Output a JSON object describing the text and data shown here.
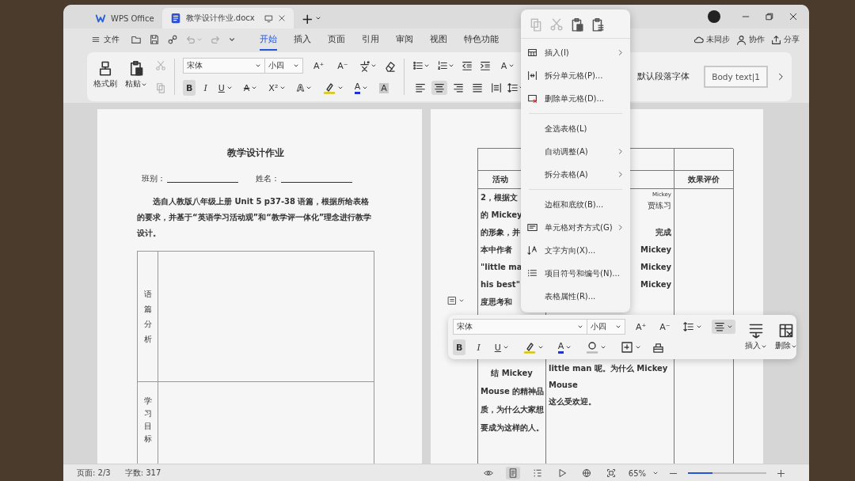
{
  "window": {
    "tabs": [
      {
        "label": "WPS Office",
        "selected": false
      },
      {
        "label": "教学设计作业.docx",
        "selected": true
      }
    ],
    "new_tab": "+"
  },
  "menubar": {
    "file": "文件",
    "tabs": [
      {
        "label": "开始",
        "selected": true
      },
      {
        "label": "插入",
        "selected": false
      },
      {
        "label": "页面",
        "selected": false
      },
      {
        "label": "引用",
        "selected": false
      },
      {
        "label": "审阅",
        "selected": false
      },
      {
        "label": "视图",
        "selected": false
      },
      {
        "label": "特色功能",
        "selected": false
      }
    ],
    "actions": [
      "未同步",
      "协作",
      "分享"
    ]
  },
  "ribbon": {
    "clipboard": [
      "格式刷",
      "粘贴"
    ],
    "clipboard_tools": [
      {
        "disabled": true
      },
      {
        "disabled": true
      }
    ],
    "font": "宋体",
    "size": "小四",
    "size_buttons": [
      "A⁺",
      "A⁻"
    ],
    "format_buttons": [
      {
        "label": "B",
        "kind": "bold",
        "selected": true
      },
      {
        "label": "I",
        "kind": "italic",
        "selected": false
      },
      {
        "label": "U",
        "kind": "underline",
        "selected": false
      },
      {
        "label": "A",
        "kind": "strike",
        "selected": false
      },
      {
        "label": "X²",
        "kind": "superscript",
        "selected": false
      },
      {
        "label": "A",
        "kind": "outline",
        "selected": false
      },
      {
        "kind": "highlight",
        "selected": false
      },
      {
        "label": "A",
        "kind": "font-color",
        "selected": false
      },
      {
        "label": "A",
        "kind": "shading",
        "selected": false
      }
    ],
    "text_effect_button": "A",
    "align": [
      {
        "selected": false
      },
      {
        "selected": true
      },
      {
        "selected": false
      },
      {
        "selected": false
      },
      {
        "selected": false
      }
    ],
    "styles": [
      {
        "label": "默认段落字体",
        "selected": false
      },
      {
        "label": "Body text|1",
        "selected": true
      }
    ]
  },
  "document": {
    "left_page": {
      "title": "教学设计作业",
      "fields": [
        "班别：",
        "姓名："
      ],
      "paragraph": "选自人教版八年级上册 Unit 5 p37-38 语篇，根据所给表格的要求，并基于“英语学习活动观”和“教学评一体化”理念进行教学设计。",
      "table_rows": [
        "语篇分析",
        "学习目标"
      ]
    },
    "right_page": {
      "headers": [
        "活动",
        "效果评价"
      ],
      "column_1_top": [
        "2，根据文",
        "的 Mickey",
        "的形象，并",
        "本中作者",
        "\"little ma",
        "his best\"",
        "度思考和"
      ],
      "column_1_bottom": [
        "结 Mickey",
        "Mouse 的精神品",
        "质，为什么大家想",
        "要成为这样的人。"
      ],
      "column_2_top": [
        {
          "text": "Mickey",
          "kind": "note"
        },
        {
          "text": "贾练习",
          "kind": "note"
        },
        {
          "text": "完成",
          "kind": "line"
        },
        {
          "text": "Mickey",
          "kind": "line"
        },
        {
          "text": "Mickey",
          "kind": "line"
        },
        {
          "text": "Mickey",
          "kind": "line"
        }
      ],
      "column_2_bottom": [
        "little man 呢。为什么 Mickey Mouse",
        "这么受欢迎。"
      ]
    }
  },
  "context_menu": {
    "tools": [
      {
        "disabled": true
      },
      {
        "disabled": true
      },
      {
        "disabled": false
      },
      {
        "disabled": false
      }
    ],
    "items": [
      {
        "kind": "item",
        "label": "插入(I)",
        "submenu": true
      },
      {
        "kind": "item",
        "label": "拆分单元格(P)...",
        "submenu": false
      },
      {
        "kind": "item",
        "label": "删除单元格(D)...",
        "submenu": false
      },
      {
        "kind": "separator"
      },
      {
        "kind": "item",
        "label": "全选表格(L)",
        "submenu": false
      },
      {
        "kind": "item",
        "label": "自动调整(A)",
        "submenu": true
      },
      {
        "kind": "item",
        "label": "拆分表格(A)",
        "submenu": true
      },
      {
        "kind": "separator"
      },
      {
        "kind": "item",
        "label": "边框和底纹(B)...",
        "submenu": false
      },
      {
        "kind": "item",
        "label": "单元格对齐方式(G)",
        "submenu": true
      },
      {
        "kind": "item",
        "label": "文字方向(X)...",
        "submenu": false
      },
      {
        "kind": "item",
        "label": "项目符号和编号(N)...",
        "submenu": false
      },
      {
        "kind": "item",
        "label": "表格属性(R)...",
        "submenu": false
      }
    ]
  },
  "floating_toolbar": {
    "font": "宋体",
    "size": "小四",
    "size_buttons": [
      "A⁺",
      "A⁻"
    ],
    "paragraph_tools": [
      {
        "selected": false
      },
      {
        "selected": true
      }
    ],
    "format_buttons": [
      {
        "label": "B",
        "kind": "bold",
        "selected": true
      },
      {
        "label": "I",
        "kind": "italic",
        "selected": false
      },
      {
        "label": "U",
        "kind": "underline",
        "selected": false
      },
      {
        "kind": "highlight",
        "selected": false
      },
      {
        "label": "A",
        "kind": "font-color",
        "selected": false
      },
      {
        "kind": "shading",
        "selected": false
      },
      {
        "kind": "border",
        "selected": false
      }
    ],
    "actions": [
      "插入",
      "删除"
    ]
  },
  "status_bar": {
    "page": "页面: 2/3",
    "words": "字数: 317",
    "views": [
      {
        "selected": false
      },
      {
        "selected": true
      },
      {
        "selected": false
      },
      {
        "selected": false
      },
      {
        "selected": false
      },
      {
        "selected": false
      }
    ],
    "zoom": "65%",
    "zoom_slider": {
      "level": 0.31
    }
  }
}
